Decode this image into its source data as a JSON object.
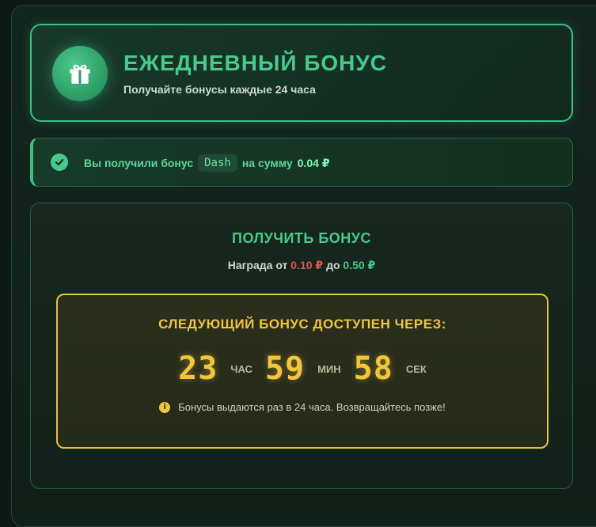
{
  "header": {
    "icon": "gift-icon",
    "title": "ЕЖЕДНЕВНЫЙ БОНУС",
    "subtitle": "Получайте бонусы каждые 24 часа"
  },
  "alert": {
    "icon": "check-icon",
    "text_before": "Вы получили бонус",
    "bonus_name": "Dash",
    "text_middle": "на сумму",
    "amount": "0.04 ₽"
  },
  "claim": {
    "title": "ПОЛУЧИТЬ БОНУС",
    "reward_prefix": "Награда от",
    "reward_min": "0.10 ₽",
    "reward_sep": "до",
    "reward_max": "0.50 ₽"
  },
  "countdown": {
    "title": "СЛЕДУЮЩИЙ БОНУС ДОСТУПЕН ЧЕРЕЗ:",
    "hours": "23",
    "hours_unit": "ЧАС",
    "minutes": "59",
    "minutes_unit": "МИН",
    "seconds": "58",
    "seconds_unit": "СЕК",
    "info_icon": "info-icon",
    "info_text": "Бонусы выдаются раз в 24 часа. Возвращайтесь позже!"
  },
  "colors": {
    "accent_green": "#46c98b",
    "accent_gold": "#f2c53d",
    "danger_red": "#e05555"
  }
}
